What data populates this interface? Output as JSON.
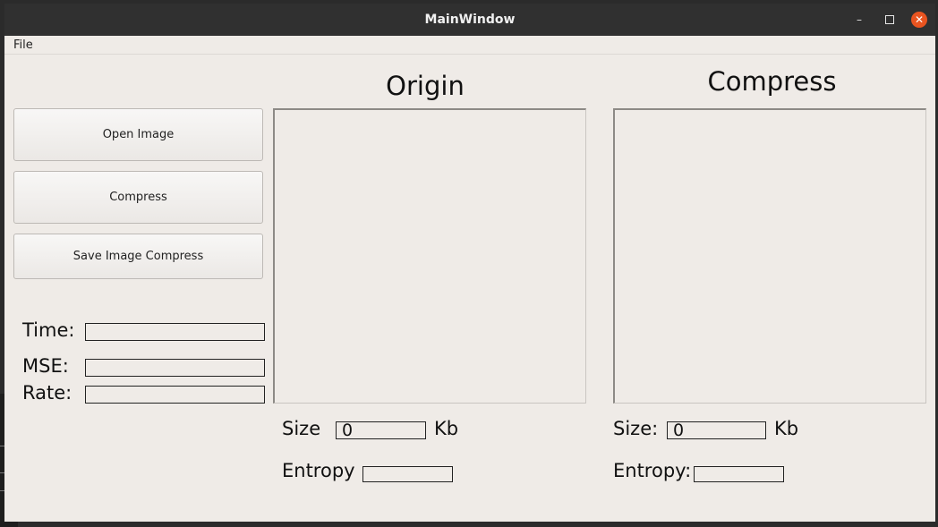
{
  "window": {
    "title": "MainWindow",
    "controls": {
      "minimize": "minimize-icon",
      "maximize": "maximize-icon",
      "close": "close-icon"
    }
  },
  "menu": {
    "file": "File"
  },
  "buttons": {
    "open": "Open Image",
    "compress": "Compress",
    "save": "Save Image Compress"
  },
  "metrics": {
    "time_label": "Time:",
    "mse_label": "MSE:",
    "rate_label": "Rate:",
    "time_value": "",
    "mse_value": "",
    "rate_value": ""
  },
  "origin": {
    "heading": "Origin",
    "size_label": "Size",
    "size_value": "0",
    "size_unit": "Kb",
    "entropy_label": "Entropy",
    "entropy_value": ""
  },
  "compress": {
    "heading": "Compress",
    "size_label": "Size:",
    "size_value": "0",
    "size_unit": "Kb",
    "entropy_label": "Entropy:",
    "entropy_value": ""
  },
  "colors": {
    "window_bg": "#efebe7",
    "titlebar_bg": "#303030",
    "close_button": "#e95420"
  }
}
